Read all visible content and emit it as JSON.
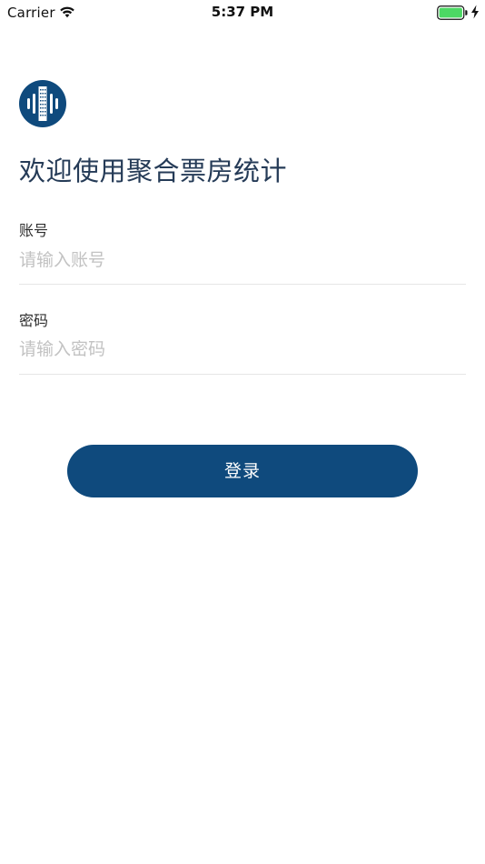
{
  "status_bar": {
    "carrier": "Carrier",
    "time": "5:37 PM",
    "battery_color": "#4cd964",
    "icons": [
      "wifi-icon",
      "battery-icon",
      "charging-icon"
    ]
  },
  "logo": {
    "icon": "app-logo-icon",
    "color": "#0f4a7d"
  },
  "title": "欢迎使用聚合票房统计",
  "form": {
    "account": {
      "label": "账号",
      "placeholder": "请输入账号",
      "value": ""
    },
    "password": {
      "label": "密码",
      "placeholder": "请输入密码",
      "value": ""
    }
  },
  "login_button": {
    "label": "登录",
    "color": "#0f4a7d"
  }
}
